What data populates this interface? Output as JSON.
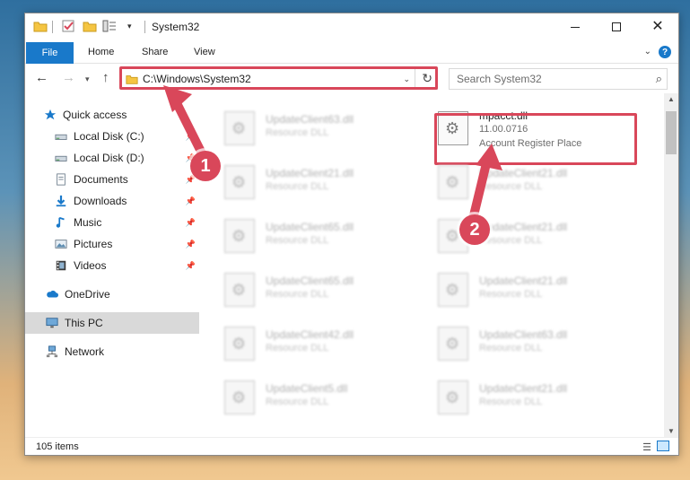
{
  "window": {
    "title": "System32"
  },
  "ribbon": {
    "tabs": [
      "File",
      "Home",
      "Share",
      "View"
    ],
    "help_label": "?"
  },
  "navbar": {
    "address_path": "C:\\Windows\\System32",
    "search_placeholder": "Search System32"
  },
  "sidebar": {
    "items": [
      {
        "label": "Quick access",
        "icon": "star-icon",
        "pinned": false
      },
      {
        "label": "Local Disk (C:)",
        "icon": "drive-icon",
        "pinned": true
      },
      {
        "label": "Local Disk (D:)",
        "icon": "drive-icon",
        "pinned": true
      },
      {
        "label": "Documents",
        "icon": "documents-icon",
        "pinned": true
      },
      {
        "label": "Downloads",
        "icon": "download-icon",
        "pinned": true
      },
      {
        "label": "Music",
        "icon": "music-icon",
        "pinned": true
      },
      {
        "label": "Pictures",
        "icon": "pictures-icon",
        "pinned": true
      },
      {
        "label": "Videos",
        "icon": "videos-icon",
        "pinned": true
      },
      {
        "label": "OneDrive",
        "icon": "cloud-icon",
        "pinned": false
      },
      {
        "label": "This PC",
        "icon": "computer-icon",
        "pinned": false,
        "selected": true
      },
      {
        "label": "Network",
        "icon": "network-icon",
        "pinned": false
      }
    ]
  },
  "files": {
    "featured": {
      "name": "mpacct.dll",
      "version": "11.00.0716",
      "description": "Account Register Place"
    },
    "left_column": [
      {
        "name": "UpdateClient63.dll",
        "desc": "Resource DLL"
      },
      {
        "name": "UpdateClient21.dll",
        "desc": "Resource DLL"
      },
      {
        "name": "UpdateClient65.dll",
        "desc": "Resource DLL"
      },
      {
        "name": "UpdateClient65.dll",
        "desc": "Resource DLL"
      },
      {
        "name": "UpdateClient42.dll",
        "desc": "Resource DLL"
      },
      {
        "name": "UpdateClient5.dll",
        "desc": "Resource DLL"
      }
    ],
    "right_column": [
      {
        "name": "UpdateClient21.dll",
        "desc": "Resource DLL"
      },
      {
        "name": "UpdateClient21.dll",
        "desc": "Resource DLL"
      },
      {
        "name": "UpdateClient21.dll",
        "desc": "Resource DLL"
      },
      {
        "name": "UpdateClient63.dll",
        "desc": "Resource DLL"
      },
      {
        "name": "UpdateClient21.dll",
        "desc": "Resource DLL"
      }
    ]
  },
  "status": {
    "item_count": "105 items"
  },
  "annotations": {
    "step1": "1",
    "step2": "2",
    "color": "#d9475a"
  },
  "colors": {
    "accent": "#1979ca",
    "highlight": "#d9475a"
  }
}
